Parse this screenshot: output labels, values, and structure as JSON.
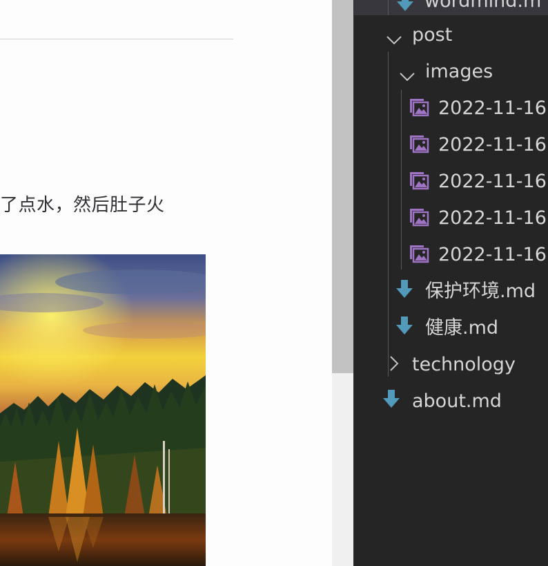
{
  "preview": {
    "paragraph_fragment": "了点水，然后肚子火",
    "image_alt": "sunset-forest-lake"
  },
  "explorer": {
    "items": [
      {
        "label": "wordmind.m",
        "type": "markdown-file",
        "expanded": null
      },
      {
        "label": "post",
        "type": "folder",
        "expanded": true
      },
      {
        "label": "images",
        "type": "folder",
        "expanded": true
      },
      {
        "label": "2022-11-16",
        "type": "image-file"
      },
      {
        "label": "2022-11-16",
        "type": "image-file"
      },
      {
        "label": "2022-11-16",
        "type": "image-file"
      },
      {
        "label": "2022-11-16",
        "type": "image-file"
      },
      {
        "label": "2022-11-16",
        "type": "image-file"
      },
      {
        "label": "保护环境.md",
        "type": "markdown-file"
      },
      {
        "label": "健康.md",
        "type": "markdown-file"
      },
      {
        "label": "technology",
        "type": "folder",
        "expanded": false
      },
      {
        "label": "about.md",
        "type": "markdown-file"
      }
    ]
  },
  "colors": {
    "explorer_bg": "#252526",
    "markdown_icon": "#519aba",
    "image_icon": "#a074c4",
    "preview_text": "#2f3033"
  }
}
